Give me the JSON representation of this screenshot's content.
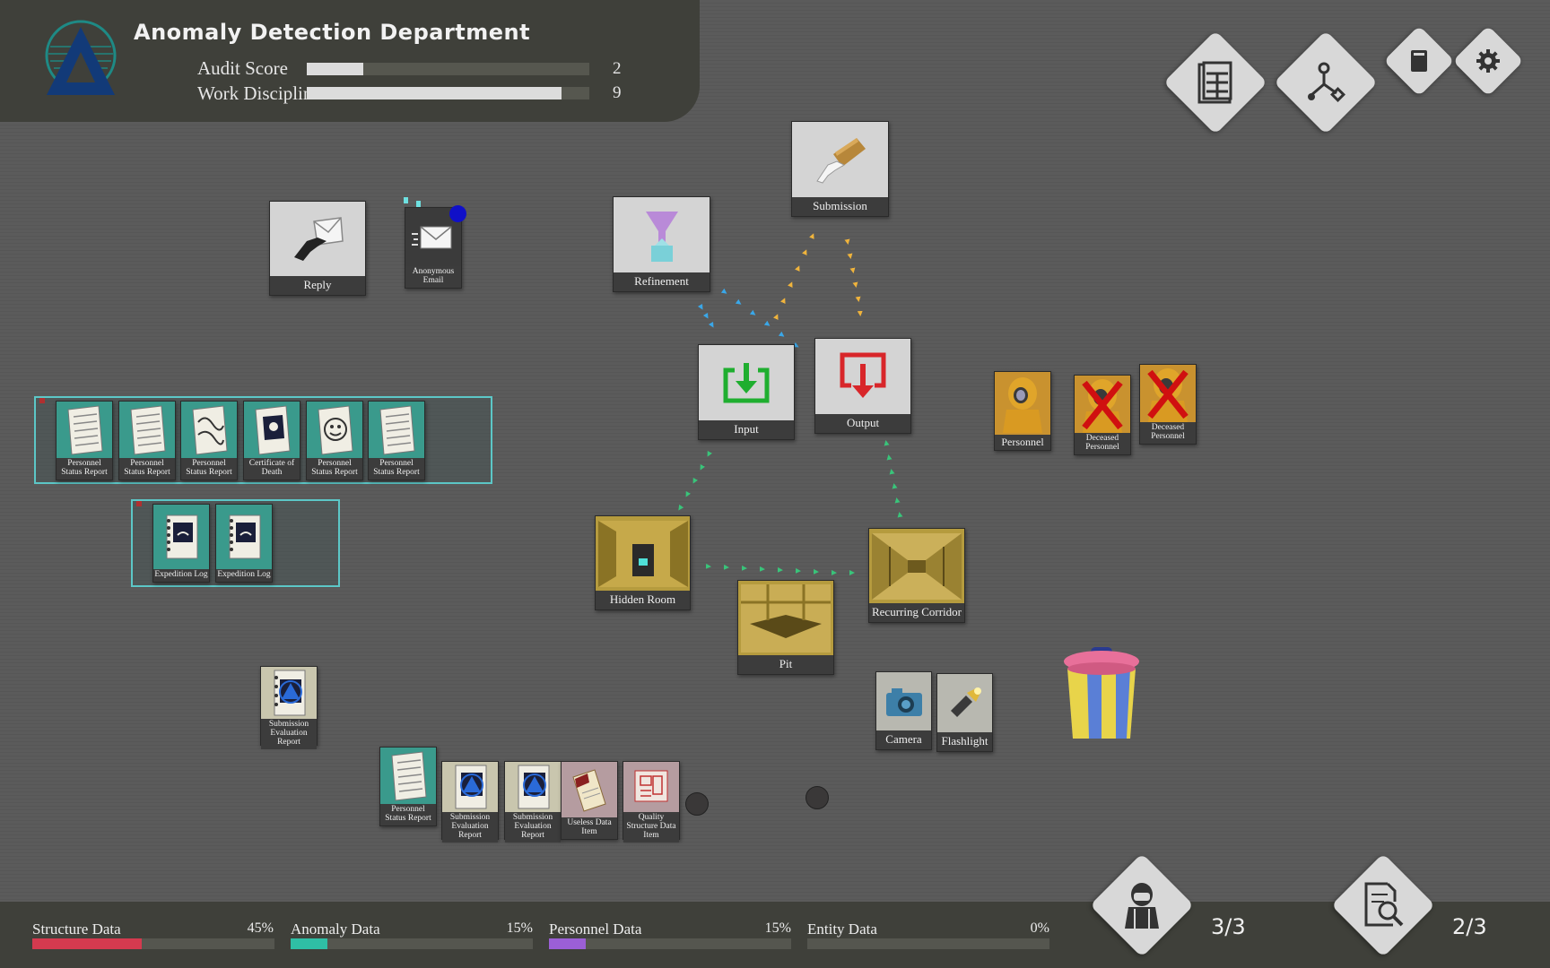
{
  "header": {
    "title": "Anomaly Detection Department",
    "stats": [
      {
        "label": "Audit Score",
        "value": "2",
        "fill": 0.2
      },
      {
        "label": "Work Discipline",
        "value": "9",
        "fill": 0.9
      }
    ]
  },
  "toolbar": {
    "buttons": [
      {
        "name": "archive-button",
        "icon": "file-cabinet-icon"
      },
      {
        "name": "flowchart-button",
        "icon": "flowchart-icon"
      },
      {
        "name": "manual-button",
        "icon": "book-icon"
      },
      {
        "name": "settings-button",
        "icon": "gear-icon"
      }
    ]
  },
  "nodes": {
    "reply": "Reply",
    "anonymous_email": "Anonymous Email",
    "refinement": "Refinement",
    "submission": "Submission",
    "input": "Input",
    "output": "Output",
    "hidden_room": "Hidden Room",
    "recurring_corridor": "Recurring Corridor",
    "pit": "Pit",
    "camera": "Camera",
    "flashlight": "Flashlight"
  },
  "personnel": [
    {
      "label": "Personnel"
    },
    {
      "label": "Deceased Personnel"
    },
    {
      "label": "Deceased Personnel"
    }
  ],
  "group1": [
    {
      "label": "Personnel Status Report"
    },
    {
      "label": "Personnel Status Report"
    },
    {
      "label": "Personnel Status Report"
    },
    {
      "label": "Certificate of Death"
    },
    {
      "label": "Personnel Status Report"
    },
    {
      "label": "Personnel Status Report"
    }
  ],
  "group2": [
    {
      "label": "Expedition Log"
    },
    {
      "label": "Expedition Log"
    }
  ],
  "loose_card": {
    "label": "Submission Evaluation Report"
  },
  "bottom_row": [
    {
      "label": "Personnel Status Report"
    },
    {
      "label": "Submission Evaluation Report"
    },
    {
      "label": "Submission Evaluation Report"
    },
    {
      "label": "Useless Data Item"
    },
    {
      "label": "Quality Structure Data Item"
    }
  ],
  "data_bars": [
    {
      "label": "Structure Data",
      "pct": "45%",
      "fill": 0.45,
      "color": "#d43a4f"
    },
    {
      "label": "Anomaly Data",
      "pct": "15%",
      "fill": 0.15,
      "color": "#2fbfa5"
    },
    {
      "label": "Personnel Data",
      "pct": "15%",
      "fill": 0.15,
      "color": "#9b5fd6"
    },
    {
      "label": "Entity Data",
      "pct": "0%",
      "fill": 0.0,
      "color": "#cccccc"
    }
  ],
  "counters": {
    "personnel": "3/3",
    "investigation": "2/3"
  },
  "colors": {
    "blue_arrow": "#3aa7e8",
    "yellow_arrow": "#f0b43c",
    "green_arrow": "#39c47a"
  }
}
